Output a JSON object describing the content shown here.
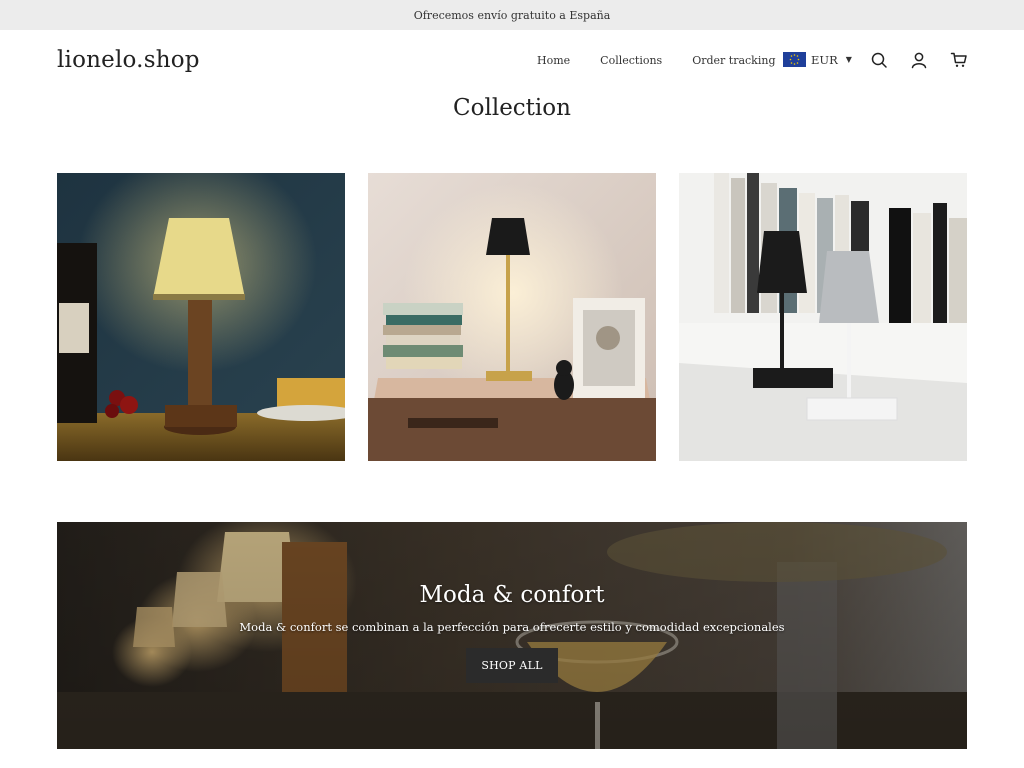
{
  "announcement": {
    "text": "Ofrecemos envío gratuito a España"
  },
  "header": {
    "logo": "lionelo.shop",
    "nav": [
      {
        "label": "Home"
      },
      {
        "label": "Collections"
      },
      {
        "label": "Order tracking"
      }
    ],
    "currency": {
      "code": "EUR",
      "flag": "eu-flag-icon"
    },
    "icons": [
      "search-icon",
      "account-icon",
      "cart-icon"
    ]
  },
  "page": {
    "title": "Collection"
  },
  "collections": [
    {
      "image": "table-lamp-fabric-shade-on-dinner-table"
    },
    {
      "image": "black-gold-lamp-on-dresser-with-books"
    },
    {
      "image": "black-and-white-lamps-on-bookshelf"
    }
  ],
  "banner": {
    "title": "Moda & confort",
    "subtitle": "Moda & confort se combinan a la perfección para ofrecerte estilo y comodidad excepcionales",
    "button_label": "SHOP ALL"
  },
  "colors": {
    "announcement_bg": "#ececec",
    "button_bg": "#2b2b2b",
    "eu_blue": "#1f3f9a"
  }
}
